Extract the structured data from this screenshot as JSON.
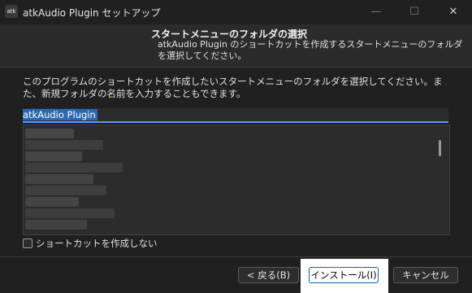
{
  "window": {
    "icon_text": "atk",
    "title": "atkAudio Plugin セットアップ",
    "minimize": "—",
    "maximize": "☐",
    "close": "✕"
  },
  "header": {
    "title": "スタートメニューのフォルダの選択",
    "subtitle": "atkAudio Plugin のショートカットを作成するスタートメニューのフォルダを選択してください。"
  },
  "description": "このプログラムのショートカットを作成したいスタートメニューのフォルダを選択してください。また、新規フォルダの名前を入力することもできます。",
  "folder_input": {
    "value": "atkAudio Plugin"
  },
  "checkbox": {
    "label": "ショートカットを作成しない",
    "checked": false
  },
  "buttons": {
    "back": "< 戻る(B)",
    "install": "インストール(I)",
    "cancel": "キャンセル"
  },
  "colors": {
    "accent": "#4aa3ff",
    "selection": "#2b68b2",
    "background": "#202020",
    "highlight": "#ffffff"
  }
}
